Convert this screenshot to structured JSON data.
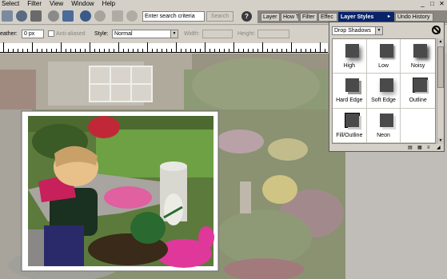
{
  "menu": [
    "Select",
    "Filter",
    "View",
    "Window",
    "Help"
  ],
  "window_controls": [
    "_",
    "□",
    "✕"
  ],
  "toolbar": {
    "search_placeholder": "Enter search criteria",
    "search_button": "Search",
    "help": "?"
  },
  "palette_tabs": [
    "Layer",
    "How T",
    "Filter",
    "Effec"
  ],
  "active_tab": "Layer Styles",
  "active_tab_arrow": "▸",
  "history_tab": "Undo History",
  "options": {
    "feather_label": "eather:",
    "feather_value": "0 px",
    "anti_aliased_label": "Anti-aliased",
    "style_label": "Style:",
    "style_value": "Normal",
    "width_label": "Width:",
    "height_label": "Height:"
  },
  "layer_styles": {
    "category": "Drop Shadows",
    "swatches": [
      "High",
      "Low",
      "Noisy",
      "Hard Edge",
      "Soft Edge",
      "Outline",
      "Fill/Outline",
      "Neon",
      ""
    ]
  },
  "colors": {
    "chrome": "#d4d0c8",
    "active_tab": "#0a246a",
    "swatch_shape": "#4a4a4a"
  },
  "icons": [
    "rectangle-select-icon",
    "lasso-icon",
    "stamp-icon",
    "eye-icon",
    "undo-icon",
    "redo-icon",
    "brush-icon",
    "palette-icon",
    "help-icon",
    "clear-style-icon"
  ]
}
